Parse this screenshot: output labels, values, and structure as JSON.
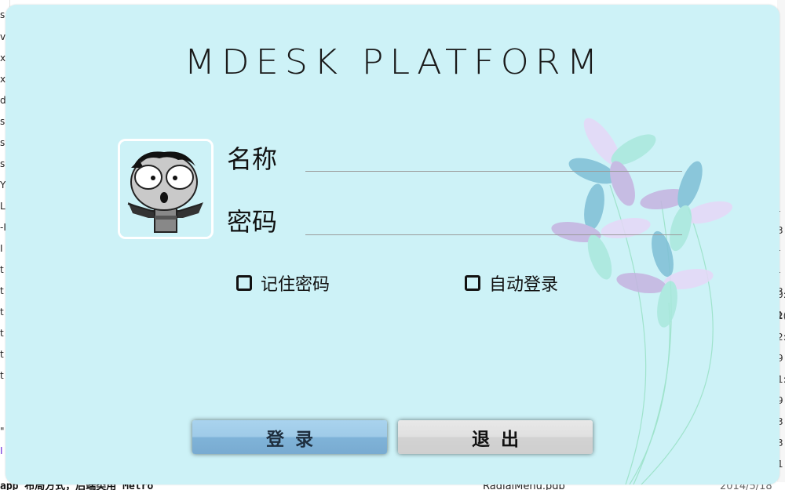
{
  "app": {
    "title": "MDESK PLATFORM"
  },
  "form": {
    "name_label": "名称",
    "password_label": "密码",
    "name_value": "",
    "password_value": ""
  },
  "options": {
    "remember_label": "记住密码",
    "remember_checked": false,
    "autologin_label": "自动登录",
    "autologin_checked": false
  },
  "buttons": {
    "login_label": "登录",
    "exit_label": "退出"
  },
  "background": {
    "left_chars": [
      "s.",
      "v",
      "x",
      "x",
      "d",
      "s",
      "s",
      "s",
      "Y",
      "L",
      "-I",
      "I",
      "t",
      "t",
      "t",
      "t",
      "t",
      "t",
      "\"",
      "I"
    ],
    "right_chars": [
      "-",
      "3",
      "-",
      "-",
      "3",
      "1",
      "0:",
      "2(",
      "2:",
      "9",
      "1:",
      "9",
      "3",
      "3",
      "1"
    ],
    "bottom_left_text": "app 布局方式，后端类用 Metro",
    "bottom_file_text": "RadialMenu.pdb",
    "bottom_date_text": "2014/5/18"
  },
  "colors": {
    "dialog_bg": "#cdf2f7",
    "login_button": "#8fbfe0",
    "exit_button": "#dcdcdc"
  }
}
